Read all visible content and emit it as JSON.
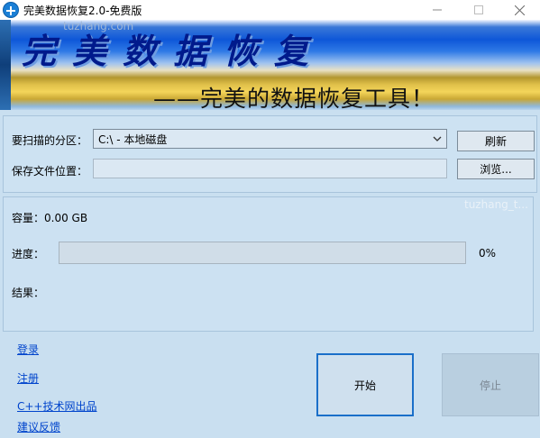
{
  "window": {
    "title": "完美数据恢复2.0-免费版",
    "minimize_icon": "minimize-icon",
    "maximize_icon": "maximize-icon",
    "close_icon": "close-icon"
  },
  "banner": {
    "title": "完美数据恢复",
    "subtitle": "——完美的数据恢复工具！",
    "watermark": "tuzhang.com"
  },
  "form": {
    "partition_label": "要扫描的分区：",
    "partition_value": "C:\\  -  本地磁盘",
    "save_label": "保存文件位置：",
    "save_value": "",
    "refresh_label": "刷新",
    "browse_label": "浏览..."
  },
  "info": {
    "capacity_label": "容量：",
    "capacity_value": "0.00 GB",
    "progress_label": "进度：",
    "progress_fraction": 0,
    "progress_text": "0%",
    "result_label": "结果："
  },
  "watermark2": "tuzhang_t...",
  "links": {
    "login": "登录",
    "register": "注册",
    "cpp_site": "C++技术网出品",
    "feedback": "建议反馈"
  },
  "actions": {
    "start_label": "开始",
    "stop_label": "停止"
  },
  "colors": {
    "background": "#c9dff0",
    "accent": "#1a6fc9",
    "link": "#0044cc",
    "banner_title": "#001a8c"
  }
}
